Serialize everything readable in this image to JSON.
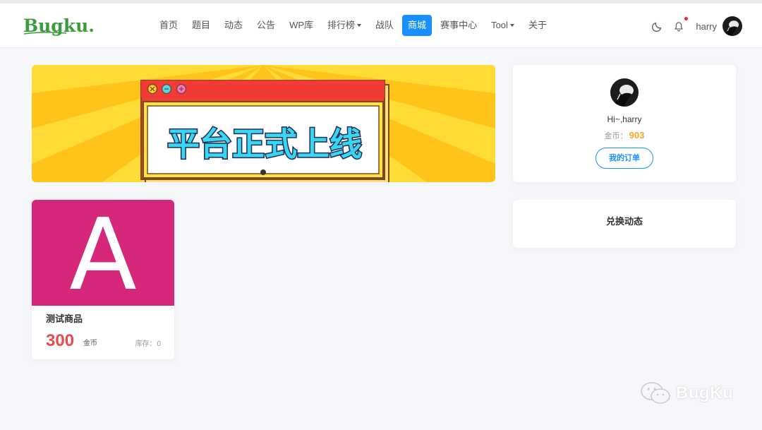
{
  "brand": {
    "logo_text": "Bugku..."
  },
  "nav": {
    "items": [
      {
        "label": "首页"
      },
      {
        "label": "题目"
      },
      {
        "label": "动态"
      },
      {
        "label": "公告"
      },
      {
        "label": "WP库"
      },
      {
        "label": "排行榜"
      },
      {
        "label": "战队"
      },
      {
        "label": "商城"
      },
      {
        "label": "赛事中心"
      },
      {
        "label": "Tool"
      },
      {
        "label": "关于"
      }
    ],
    "active": "商城",
    "dropdown_items": [
      "排行榜",
      "Tool"
    ]
  },
  "header": {
    "username": "harry",
    "icons": [
      "moon-icon",
      "bell-icon"
    ],
    "has_notification": true
  },
  "banner": {
    "headline": "平台正式上线",
    "window_buttons": [
      "close-icon",
      "minimize-icon",
      "maximize-icon"
    ]
  },
  "user_card": {
    "greeting": "Hi~,harry",
    "coins_label": "金币：",
    "coins_value": "903",
    "orders_button": "我的订单"
  },
  "activity_card": {
    "title": "兑换动态"
  },
  "products": [
    {
      "name": "测试商品",
      "image_letter": "A",
      "price": "300",
      "price_unit": "金币",
      "stock_label": "库存：",
      "stock_value": "0"
    }
  ],
  "watermark": {
    "text": "BugKu"
  },
  "colors": {
    "accent": "#1890ff",
    "price": "#e74c4c",
    "coins": "#f5a623",
    "product_bg": "#d6287a",
    "banner_yellow": "#ffd21f",
    "banner_red": "#f23a36"
  }
}
